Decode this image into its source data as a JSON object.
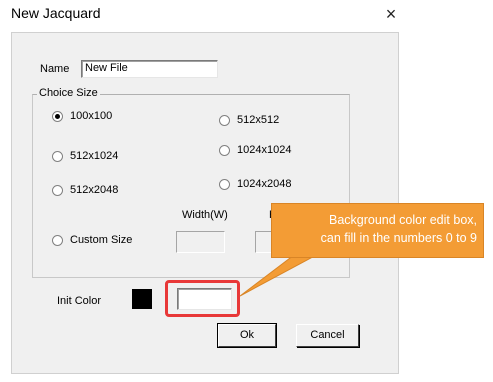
{
  "window": {
    "title": "New Jacquard",
    "close_glyph": "×"
  },
  "form": {
    "name_label": "Name",
    "name_value": "New File",
    "choice_size_title": "Choice Size",
    "sizes": {
      "s100": "100x100",
      "s512x512": "512x512",
      "s512x1024": "512x1024",
      "s1024x1024": "1024x1024",
      "s512x2048": "512x2048",
      "s1024x2048": "1024x2048",
      "custom": "Custom Size"
    },
    "selected_size": "100x100",
    "width_label": "Width(W)",
    "height_label_partial": "H",
    "width_value": "",
    "height_value": "",
    "init_color_label": "Init Color",
    "init_color_value": "",
    "init_color_swatch": "#000000"
  },
  "buttons": {
    "ok": "Ok",
    "cancel": "Cancel"
  },
  "annotation": {
    "line1": "Background color edit box,",
    "line2": "can fill in the numbers 0 to 9",
    "callout_color": "#f39c35",
    "highlight_color": "#e83838"
  }
}
